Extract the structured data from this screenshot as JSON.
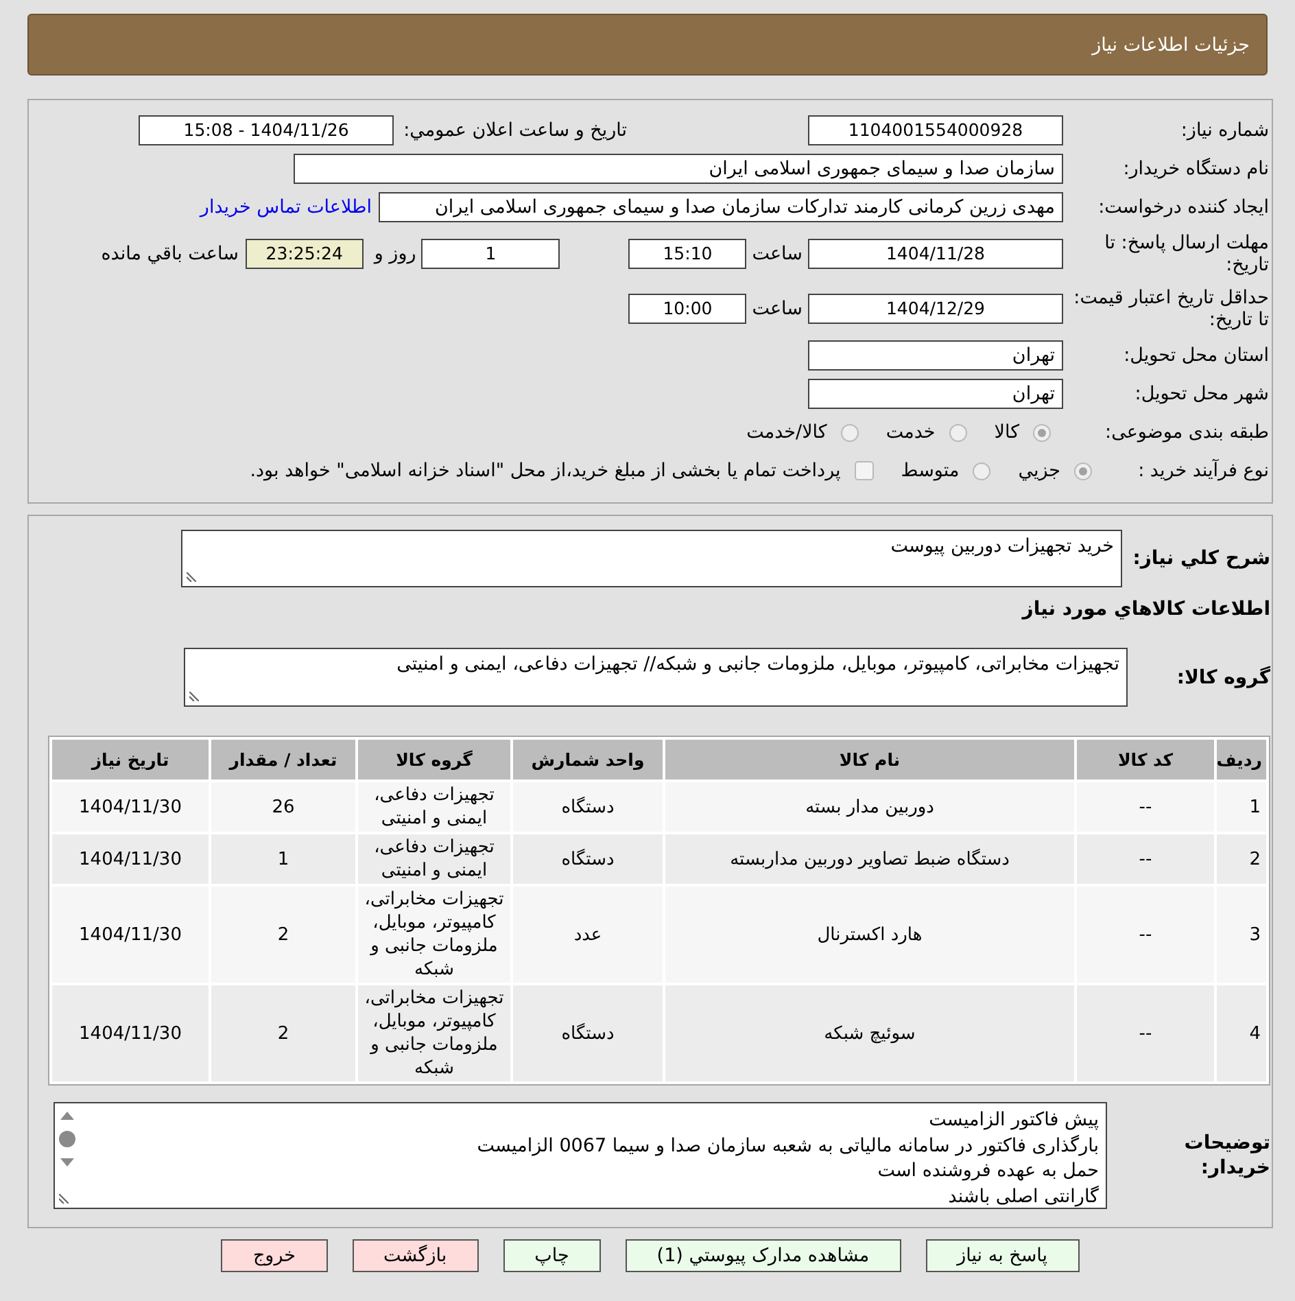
{
  "header": {
    "title": "جزئیات اطلاعات نیاز"
  },
  "summary": {
    "need_number": {
      "label": "شماره نیاز:",
      "value": "1104001554000928"
    },
    "announcement": {
      "label": "تاريخ و ساعت اعلان عمومي:",
      "value": "1404/11/26 - 15:08"
    },
    "buyer_org": {
      "label": "نام دستگاه خریدار:",
      "value": "سازمان صدا و سیمای جمهوری اسلامی ایران"
    },
    "requester": {
      "label": "ایجاد کننده درخواست:",
      "value": "مهدی زرین کرمانی کارمند تدارکات سازمان صدا و سیمای جمهوری اسلامی ایران",
      "contact_link": "اطلاعات تماس خریدار"
    },
    "reply_deadline": {
      "label": "مهلت ارسال پاسخ: تا تاریخ:",
      "date": "1404/11/28",
      "time_label": "ساعت",
      "time": "15:10",
      "days": "1",
      "days_label": "روز و",
      "remaining": "23:25:24",
      "remaining_label": "ساعت باقي مانده"
    },
    "price_validity": {
      "label": "حداقل تاریخ اعتبار قیمت: تا تاریخ:",
      "date": "1404/12/29",
      "time_label": "ساعت",
      "time": "10:00"
    },
    "province": {
      "label": "استان محل تحویل:",
      "value": "تهران"
    },
    "city": {
      "label": "شهر محل تحویل:",
      "value": "تهران"
    },
    "category": {
      "label": "طبقه بندی موضوعی:",
      "options": [
        {
          "label": "کالا",
          "selected": true
        },
        {
          "label": "خدمت",
          "selected": false
        },
        {
          "label": "کالا/خدمت",
          "selected": false
        }
      ]
    },
    "purchase_process": {
      "label": "نوع فرآیند خرید :",
      "options": [
        {
          "label": "جزيي",
          "selected": true
        },
        {
          "label": "متوسط",
          "selected": false
        }
      ],
      "treasury_payment": {
        "checked": false,
        "label": "پرداخت تمام یا بخشی از مبلغ خرید،از محل \"اسناد خزانه اسلامی\" خواهد بود."
      }
    }
  },
  "items_section": {
    "description": {
      "label": "شرح کلي نیاز:",
      "value": "خرید تجهیزات دوربین پیوست"
    },
    "heading": "اطلاعات کالاهاي مورد نیاز",
    "goods_group": {
      "label": "گروه کالا:",
      "value": "تجهیزات مخابراتی، کامپیوتر، موبایل، ملزومات جانبی و شبکه// تجهیزات دفاعی، ایمنی و امنیتی"
    },
    "table": {
      "columns": [
        "ردیف",
        "کد کالا",
        "نام کالا",
        "واحد شمارش",
        "گروه کالا",
        "تعداد / مقدار",
        "تاريخ نیاز"
      ],
      "rows": [
        [
          "1",
          "--",
          "دوربین مدار بسته",
          "دستگاه",
          "تجهیزات دفاعی، ایمنی و امنیتی",
          "26",
          "1404/11/30"
        ],
        [
          "2",
          "--",
          "دستگاه ضبط تصاویر دوربین مداربسته",
          "دستگاه",
          "تجهیزات دفاعی، ایمنی و امنیتی",
          "1",
          "1404/11/30"
        ],
        [
          "3",
          "--",
          "هارد اکسترنال",
          "عدد",
          "تجهیزات مخابراتی، کامپیوتر، موبایل، ملزومات جانبی و شبکه",
          "2",
          "1404/11/30"
        ],
        [
          "4",
          "--",
          "سوئیچ شبکه",
          "دستگاه",
          "تجهیزات مخابراتی، کامپیوتر، موبایل، ملزومات جانبی و شبکه",
          "2",
          "1404/11/30"
        ]
      ]
    },
    "buyer_notes": {
      "label": "توضیحات خریدار:",
      "lines": [
        "پیش فاکتور الزامیست",
        "بارگذاری فاکتور در سامانه مالیاتی به شعبه سازمان صدا و سیما 0067 الزامیست",
        "حمل به عهده فروشنده است",
        "گارانتی اصلی باشند"
      ]
    }
  },
  "buttons": [
    {
      "label": "پاسخ به نیاز",
      "kind": "action"
    },
    {
      "label": "مشاهده مدارک پیوستي (1)",
      "kind": "action"
    },
    {
      "label": "چاپ",
      "kind": "action"
    },
    {
      "label": "بازگشت",
      "kind": "leave"
    },
    {
      "label": "خروج",
      "kind": "leave"
    }
  ]
}
